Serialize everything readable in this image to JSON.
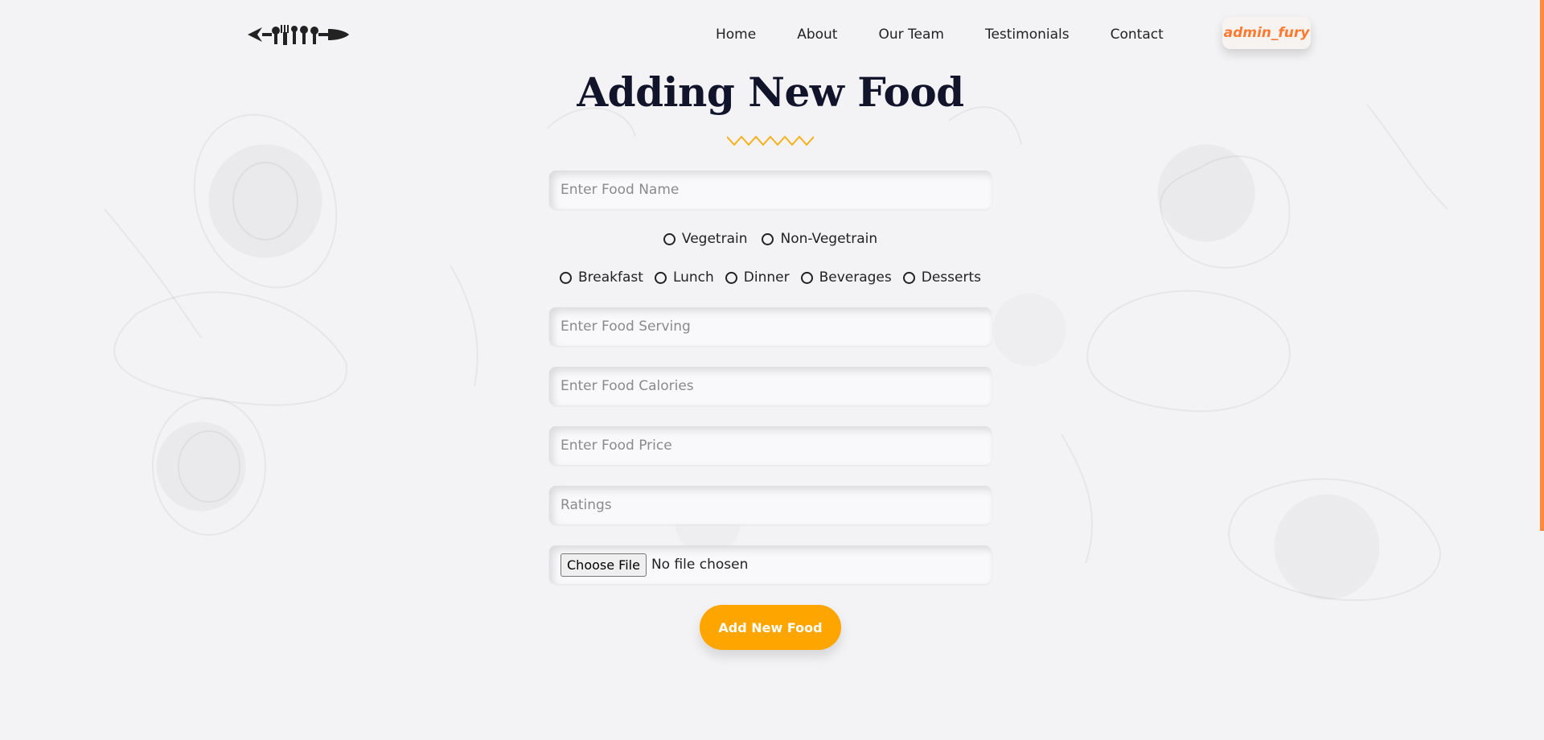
{
  "nav": {
    "home": "Home",
    "about": "About",
    "our_team": "Our Team",
    "testimonials": "Testimonials",
    "contact": "Contact",
    "user": "admin_fury"
  },
  "form": {
    "title": "Adding New Food",
    "food_name_placeholder": "Enter Food Name",
    "diet_options": [
      "Vegetrain",
      "Non-Vegetrain"
    ],
    "meal_options": [
      "Breakfast",
      "Lunch",
      "Dinner",
      "Beverages",
      "Desserts"
    ],
    "food_serving_placeholder": "Enter Food Serving",
    "food_calories_placeholder": "Enter Food Calories",
    "food_price_placeholder": "Enter Food Price",
    "ratings_placeholder": "Ratings",
    "file_button": "Choose File",
    "file_status": "No file chosen",
    "submit": "Add New Food"
  },
  "colors": {
    "accent": "#ffa500",
    "brand_orange": "#ff7a2f",
    "title": "#11142b",
    "zigzag": "#f5b11a"
  },
  "icons": {
    "logo": "utensils-logo-icon",
    "decor": "zigzag-divider-icon"
  }
}
